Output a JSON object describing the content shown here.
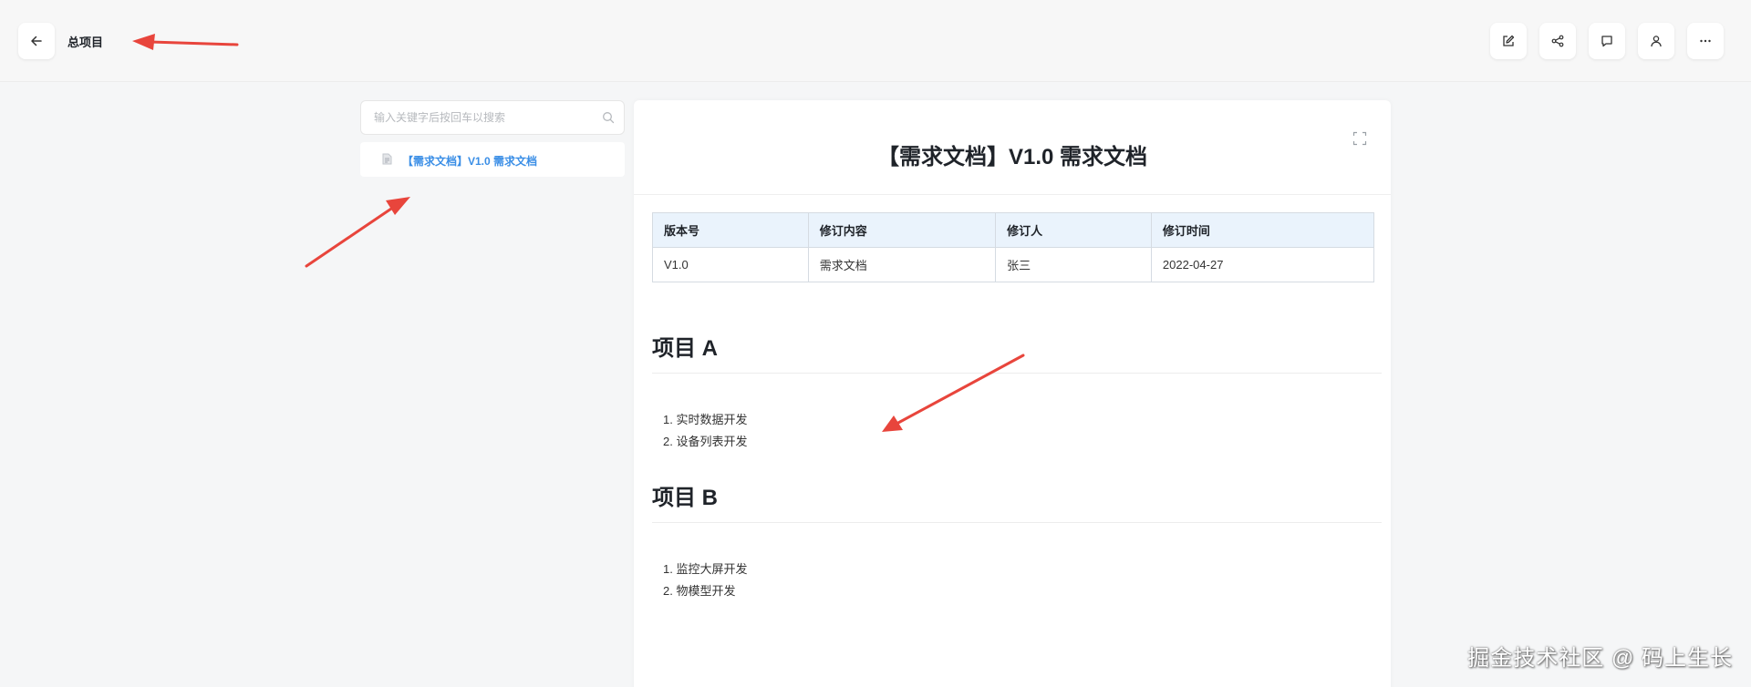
{
  "header": {
    "project_title": "总项目",
    "toolbar": [
      {
        "name": "edit-icon"
      },
      {
        "name": "share-icon"
      },
      {
        "name": "comment-icon"
      },
      {
        "name": "user-icon"
      },
      {
        "name": "more-icon"
      }
    ]
  },
  "sidebar": {
    "search": {
      "placeholder": "输入关键字后按回车以搜索",
      "value": ""
    },
    "items": [
      {
        "label": "【需求文档】V1.0 需求文档",
        "icon": "document-icon"
      }
    ]
  },
  "document": {
    "title": "【需求文档】V1.0 需求文档",
    "table": {
      "headers": [
        "版本号",
        "修订内容",
        "修订人",
        "修订时间"
      ],
      "rows": [
        [
          "V1.0",
          "需求文档",
          "张三",
          "2022-04-27"
        ]
      ]
    },
    "sections": [
      {
        "title": "项目 A",
        "items": [
          "1. 实时数据开发",
          "2. 设备列表开发"
        ]
      },
      {
        "title": "项目 B",
        "items": [
          "1. 监控大屏开发",
          "2. 物模型开发"
        ]
      }
    ]
  },
  "watermark": "掘金技术社区 @ 码上生长",
  "colors": {
    "accent": "#3a8ee6",
    "annotation_arrow": "#e8453c",
    "table_header_bg": "#eaf3fc"
  }
}
